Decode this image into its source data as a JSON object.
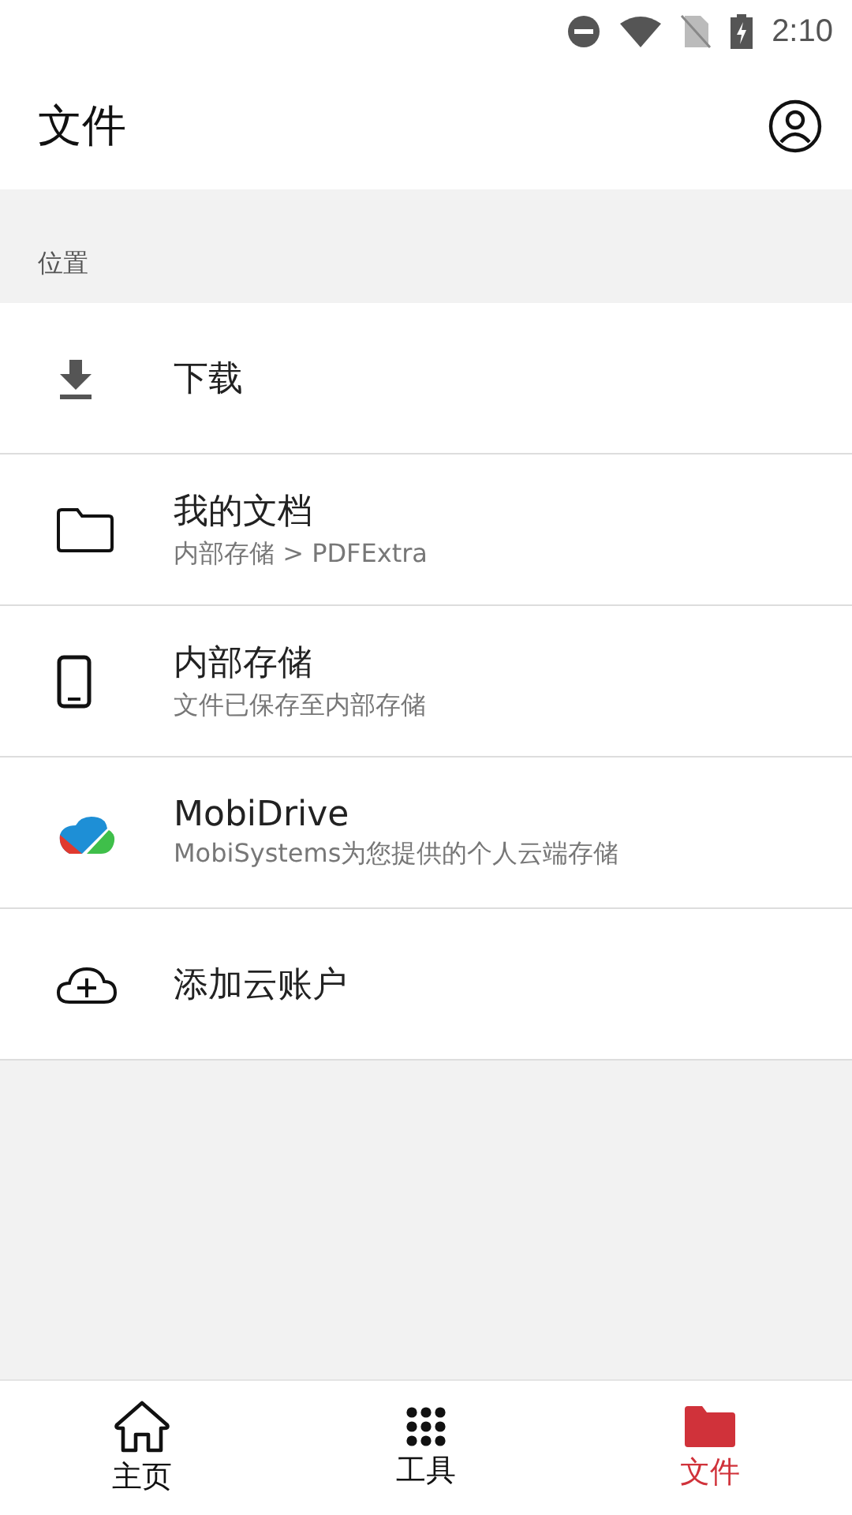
{
  "status_bar": {
    "time": "2:10"
  },
  "header": {
    "title": "文件"
  },
  "section": {
    "label": "位置"
  },
  "locations": [
    {
      "kind": "download",
      "title": "下载"
    },
    {
      "kind": "folder",
      "title": "我的文档",
      "subtitle": "内部存储 > PDFExtra"
    },
    {
      "kind": "phone",
      "title": "内部存储",
      "subtitle": "文件已保存至内部存储"
    },
    {
      "kind": "cloud-logo",
      "title": "MobiDrive",
      "subtitle": "MobiSystems为您提供的个人云端存储"
    },
    {
      "kind": "cloud-add",
      "title": "添加云账户"
    }
  ],
  "bottom_nav": [
    {
      "kind": "home",
      "label": "主页",
      "selected": false
    },
    {
      "kind": "grid",
      "label": "工具",
      "selected": false
    },
    {
      "kind": "folder",
      "label": "文件",
      "selected": true
    }
  ]
}
